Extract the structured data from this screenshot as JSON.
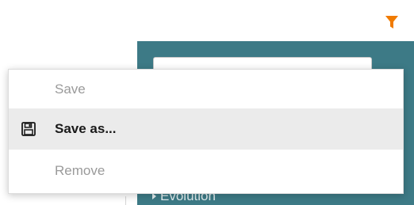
{
  "toolbar": {
    "filter_icon": "filter-icon",
    "filter_color": "#f07b00"
  },
  "panel": {
    "background": "#3d7a86",
    "section_label": "Evolution"
  },
  "context_menu": {
    "items": [
      {
        "label": "Save",
        "state": "disabled",
        "icon": ""
      },
      {
        "label": "Save as...",
        "state": "active",
        "icon": "floppy-disk-icon"
      },
      {
        "label": "Remove",
        "state": "disabled",
        "icon": ""
      }
    ]
  }
}
